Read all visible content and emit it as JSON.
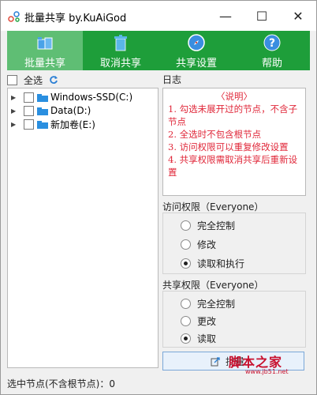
{
  "window": {
    "title": "批量共享 by.KuAiGod",
    "minimize_glyph": "—",
    "maximize_glyph": "☐",
    "close_glyph": "✕"
  },
  "toolbar": {
    "items": [
      {
        "label": "批量共享",
        "icon": "share-folders-icon",
        "active": true
      },
      {
        "label": "取消共享",
        "icon": "trash-icon",
        "active": false
      },
      {
        "label": "共享设置",
        "icon": "compass-icon",
        "active": false
      },
      {
        "label": "帮助",
        "icon": "help-icon",
        "active": false
      }
    ]
  },
  "tree": {
    "select_all_label": "全选",
    "items": [
      {
        "label": "Windows-SSD(C:)"
      },
      {
        "label": "Data(D:)"
      },
      {
        "label": "新加卷(E:)"
      }
    ]
  },
  "log": {
    "title": "日志",
    "heading": "〈说明〉",
    "lines": [
      "1. 勾选未展开过的节点，不含子节点",
      "2. 全选时不包含根节点",
      "3. 访问权限可以重复修改设置",
      "4. 共享权限需取消共享后重新设置"
    ]
  },
  "access": {
    "title": "访问权限（Everyone）",
    "options": [
      {
        "label": "完全控制",
        "checked": false
      },
      {
        "label": "修改",
        "checked": false
      },
      {
        "label": "读取和执行",
        "checked": true
      }
    ]
  },
  "share_perm": {
    "title": "共享权限（Everyone）",
    "options": [
      {
        "label": "完全控制",
        "checked": false
      },
      {
        "label": "更改",
        "checked": false
      },
      {
        "label": "读取",
        "checked": true
      }
    ]
  },
  "action_button": {
    "label": "批量",
    "icon": "share-icon"
  },
  "watermark": {
    "text": "脚本之家",
    "url": "www.jb51.net"
  },
  "status": {
    "text": "选中节点(不含根节点)：0"
  },
  "colors": {
    "toolbar_bg": "#1e9e3a",
    "toolbar_active": "#5fbe74",
    "log_text": "#e0283a"
  }
}
